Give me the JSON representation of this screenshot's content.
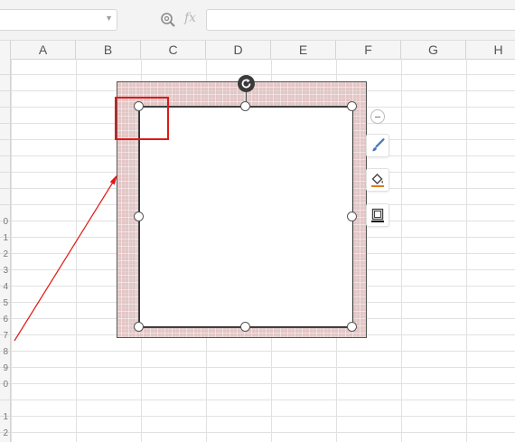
{
  "formula_bar": {
    "name_box_value": "",
    "fx_label": "fx",
    "formula_value": ""
  },
  "columns": [
    "A",
    "B",
    "C",
    "D",
    "E",
    "F",
    "G",
    "H"
  ],
  "row_numbers": [
    "0",
    "1",
    "2",
    "3",
    "4",
    "5",
    "6",
    "7",
    "8",
    "9",
    "0",
    "1",
    "2"
  ],
  "colors": {
    "annotation": "#e01818",
    "shape_fill": "#e3c6c6",
    "grid_line": "#e1e1e1"
  },
  "icons": {
    "zoom": "zoom-icon",
    "rotate": "rotate-icon",
    "collapse": "minus-icon",
    "style": "brush-icon",
    "fill": "paint-bucket-icon",
    "outline": "outline-icon"
  }
}
